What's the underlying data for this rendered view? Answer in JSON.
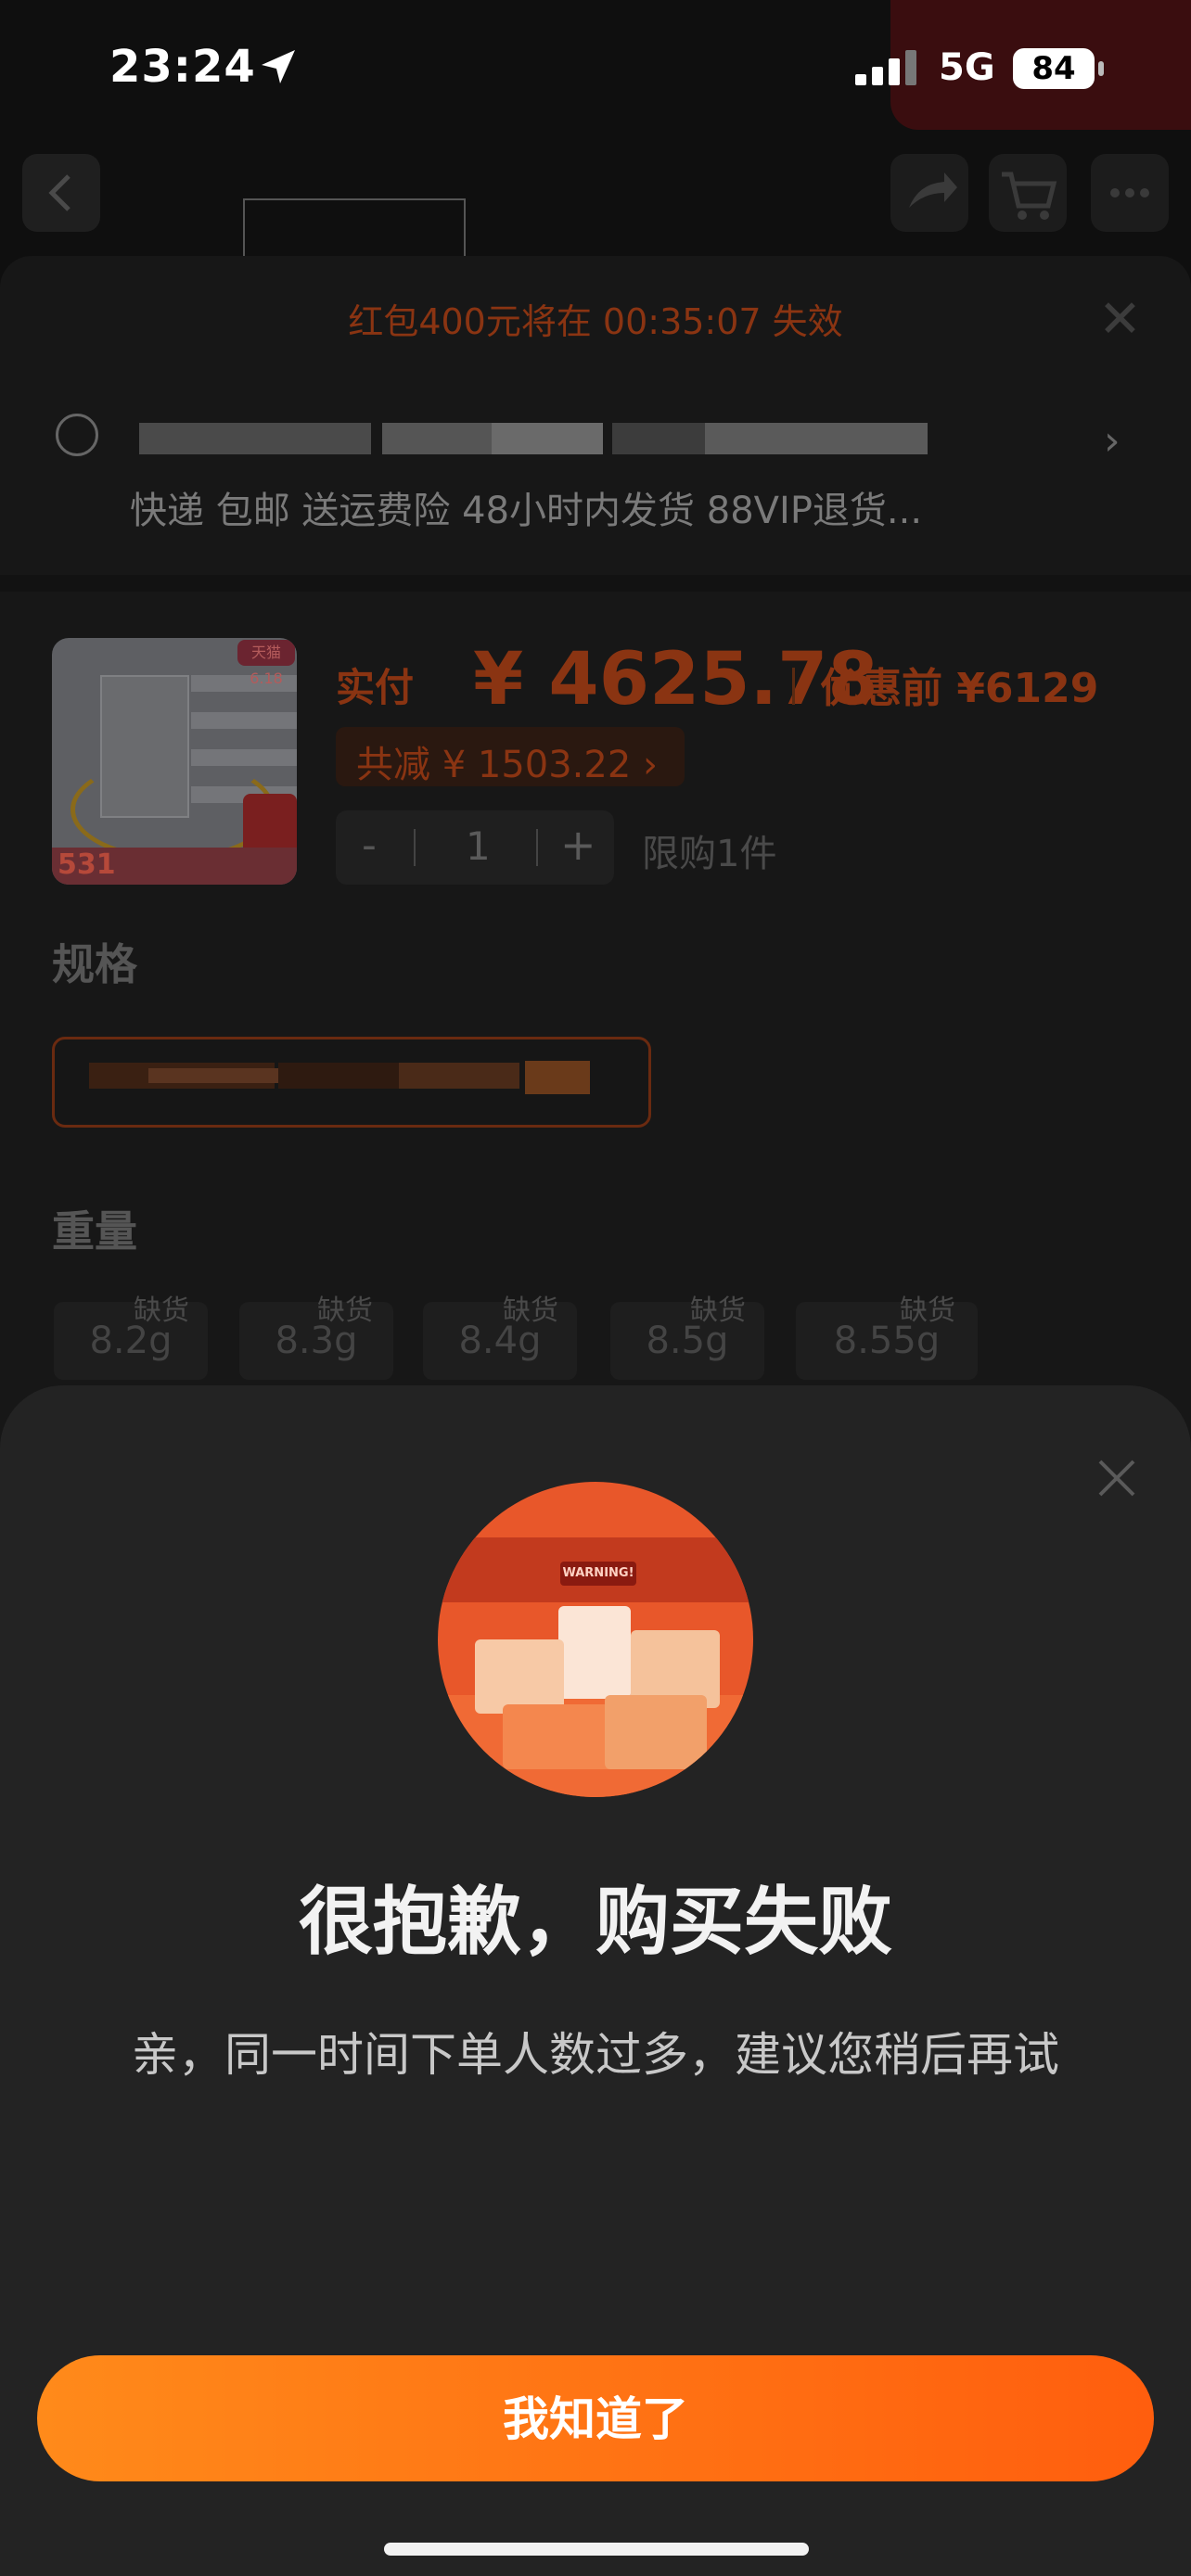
{
  "status_bar": {
    "time": "23:24",
    "network": "5G",
    "battery": "84"
  },
  "background": {
    "notice": "红包400元将在 00:35:07 失效",
    "shipping": "快递 包邮 送运费险 48小时内发货 88VIP退货...",
    "product": {
      "thumb_tag": "天猫 6.18",
      "thumb_price": "531",
      "paid_label": "实付",
      "paid_amount": "¥ 4625.78",
      "before_label": "优惠前 ¥6129",
      "saving": "共减 ¥ 1503.22 ›",
      "quantity": "1",
      "minus": "-",
      "plus": "+",
      "limit": "限购1件"
    },
    "spec_title": "规格",
    "weight_title": "重量",
    "weights": [
      {
        "label": "8.2g",
        "status": "缺货"
      },
      {
        "label": "8.3g",
        "status": "缺货"
      },
      {
        "label": "8.4g",
        "status": "缺货"
      },
      {
        "label": "8.5g",
        "status": "缺货"
      },
      {
        "label": "8.55g",
        "status": "缺货"
      }
    ]
  },
  "dialog": {
    "illustration_sign": "WARNING!",
    "title": "很抱歉，购买失败",
    "message": "亲，同一时间下单人数过多，建议您稍后再试",
    "button": "我知道了"
  },
  "colors": {
    "accent_start": "#ff8a1a",
    "accent_end": "#ff5e0e",
    "sheet_bg": "#232323"
  }
}
